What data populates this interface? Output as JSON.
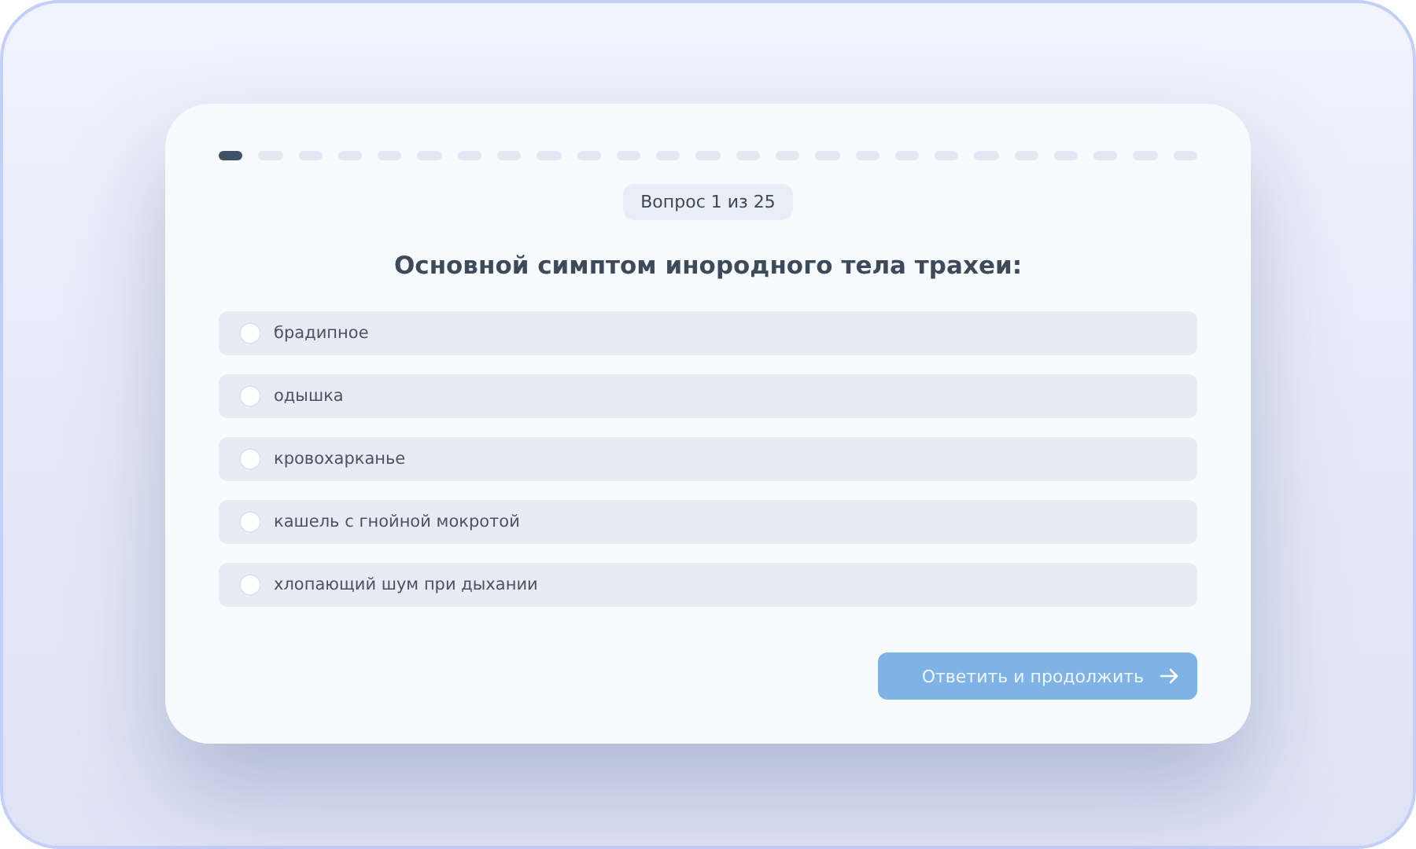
{
  "progress": {
    "steps": [
      {
        "current": true
      },
      {
        "current": false
      },
      {
        "current": false
      },
      {
        "current": false
      },
      {
        "current": false
      },
      {
        "current": false
      },
      {
        "current": false
      },
      {
        "current": false
      },
      {
        "current": false
      },
      {
        "current": false
      },
      {
        "current": false
      },
      {
        "current": false
      },
      {
        "current": false
      },
      {
        "current": false
      },
      {
        "current": false
      },
      {
        "current": false
      },
      {
        "current": false
      },
      {
        "current": false
      },
      {
        "current": false
      },
      {
        "current": false
      },
      {
        "current": false
      },
      {
        "current": false
      },
      {
        "current": false
      },
      {
        "current": false
      },
      {
        "current": false
      }
    ]
  },
  "counter": "Вопрос 1 из 25",
  "question": "Основной симптом инородного тела трахеи:",
  "options": [
    {
      "label": "брадипное",
      "selected": false
    },
    {
      "label": "одышка",
      "selected": false
    },
    {
      "label": "кровохарканье",
      "selected": false
    },
    {
      "label": "кашель с гнойной мокротой",
      "selected": false
    },
    {
      "label": "хлопающий шум при дыхании",
      "selected": false
    }
  ],
  "submit": {
    "label": "Ответить и продолжить",
    "disabled": true
  }
}
